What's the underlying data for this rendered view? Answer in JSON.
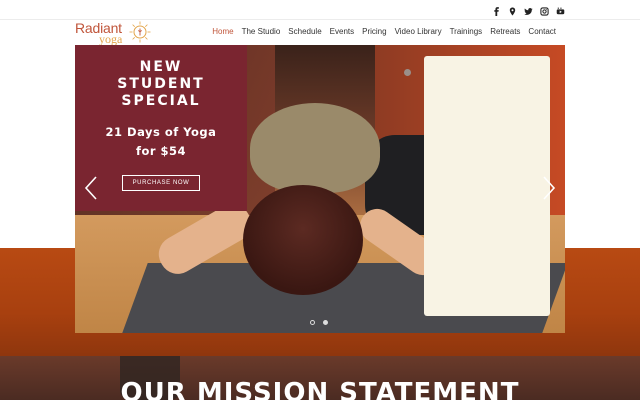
{
  "social": {
    "icons": [
      "facebook-icon",
      "map-pin-icon",
      "twitter-icon",
      "instagram-icon",
      "youtube-icon"
    ]
  },
  "logo": {
    "word1": "Radiant",
    "word2": "yoga",
    "colors": {
      "primary": "#c0553a",
      "secondary": "#e3a54a"
    }
  },
  "nav": {
    "items": [
      {
        "label": "Home",
        "active": true
      },
      {
        "label": "The Studio"
      },
      {
        "label": "Schedule"
      },
      {
        "label": "Events"
      },
      {
        "label": "Pricing"
      },
      {
        "label": "Video Library"
      },
      {
        "label": "Trainings"
      },
      {
        "label": "Retreats"
      },
      {
        "label": "Contact"
      }
    ]
  },
  "promo": {
    "title": "NEW\nSTUDENT\nSPECIAL",
    "subtitle": "21 Days of Yoga\nfor $54",
    "button": "PURCHASE NOW",
    "color": "#7a2530"
  },
  "slider": {
    "dots": 2,
    "active_dot": 1
  },
  "mission": {
    "title": "OUR MISSION STATEMENT"
  }
}
